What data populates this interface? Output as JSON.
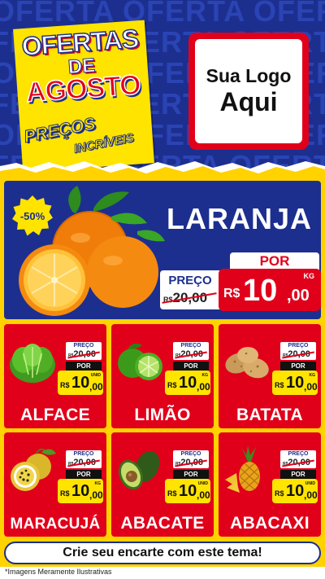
{
  "header": {
    "bg_word": "OFERTA OFERTA OFERTA",
    "title_line1": "OFERTAS",
    "title_line2": "DE",
    "title_line3": "AGOSTO",
    "subtitle_line1": "PREÇOS",
    "subtitle_line2": "INCRÍVEIS",
    "logo_line1": "Sua Logo",
    "logo_line2": "Aqui"
  },
  "hero": {
    "discount": "-50%",
    "name": "LARANJA",
    "preco_label": "PREÇO",
    "old_currency": "R$",
    "old_price": "20,00",
    "por_label": "POR",
    "currency": "R$",
    "price_int": "10",
    "price_dec": ",00",
    "unit": "KG"
  },
  "products": [
    {
      "name": "ALFACE",
      "preco_label": "PREÇO",
      "old_currency": "R$",
      "old_price": "20,00",
      "por_label": "POR",
      "currency": "R$",
      "price_int": "10",
      "price_dec": ",00",
      "unit": "UNID",
      "icon": "lettuce-icon"
    },
    {
      "name": "LIMÃO",
      "preco_label": "PREÇO",
      "old_currency": "R$",
      "old_price": "20,00",
      "por_label": "POR",
      "currency": "R$",
      "price_int": "10",
      "price_dec": ",00",
      "unit": "KG",
      "icon": "lime-icon"
    },
    {
      "name": "BATATA",
      "preco_label": "PREÇO",
      "old_currency": "R$",
      "old_price": "20,00",
      "por_label": "POR",
      "currency": "R$",
      "price_int": "10",
      "price_dec": ",00",
      "unit": "KG",
      "icon": "potato-icon"
    },
    {
      "name": "MARACUJÁ",
      "preco_label": "PREÇO",
      "old_currency": "R$",
      "old_price": "20,00",
      "por_label": "POR",
      "currency": "R$",
      "price_int": "10",
      "price_dec": ",00",
      "unit": "KG",
      "icon": "passion-fruit-icon"
    },
    {
      "name": "ABACATE",
      "preco_label": "PREÇO",
      "old_currency": "R$",
      "old_price": "20,00",
      "por_label": "POR",
      "currency": "R$",
      "price_int": "10",
      "price_dec": ",00",
      "unit": "UNID",
      "icon": "avocado-icon"
    },
    {
      "name": "ABACAXI",
      "preco_label": "PREÇO",
      "old_currency": "R$",
      "old_price": "20,00",
      "por_label": "POR",
      "currency": "R$",
      "price_int": "10",
      "price_dec": ",00",
      "unit": "UNID",
      "icon": "pineapple-icon"
    }
  ],
  "cta": "Crie seu encarte com este tema!",
  "footnote": "*Imagens Meramente Ilustrativas",
  "colors": {
    "blue": "#1c2f8f",
    "red": "#e1001a",
    "yellow": "#ffe400",
    "white": "#ffffff"
  }
}
